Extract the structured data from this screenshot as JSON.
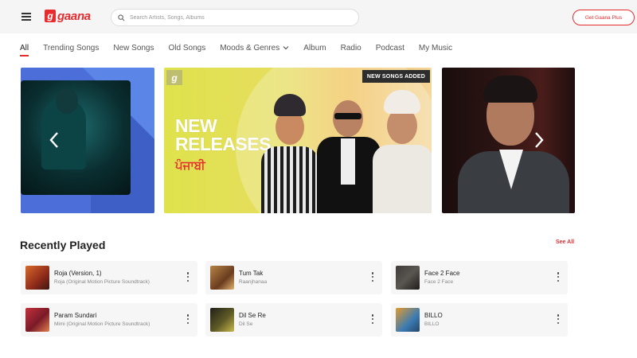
{
  "header": {
    "logo_letter": "g",
    "logo_text": "gaana",
    "search_placeholder": "Search Artists, Songs, Albums",
    "cta_label": "Get Gaana Plus"
  },
  "nav": {
    "items": [
      "All",
      "Trending Songs",
      "New Songs",
      "Old Songs",
      "Moods & Genres",
      "Album",
      "Radio",
      "Podcast",
      "My Music"
    ]
  },
  "carousel": {
    "badge_letter": "g",
    "new_songs_tag": "NEW SONGS ADDED",
    "headline_line1": "NEW",
    "headline_line2": "RELEASES",
    "language": "ਪੰਜਾਬੀ"
  },
  "recently_played": {
    "title": "Recently Played",
    "see_all": "See All",
    "items": [
      {
        "title": "Roja (Version, 1)",
        "subtitle": "Roja (Original Motion Picture Soundtrack)"
      },
      {
        "title": "Tum Tak",
        "subtitle": "Raanjhanaa"
      },
      {
        "title": "Face 2 Face",
        "subtitle": "Face 2 Face"
      },
      {
        "title": "Param Sundari",
        "subtitle": "Mimi (Original Motion Picture Soundtrack)"
      },
      {
        "title": "Dil Se Re",
        "subtitle": "Dil Se"
      },
      {
        "title": "BILLO",
        "subtitle": "BILLO"
      }
    ]
  },
  "colors": {
    "accent": "#e72c30",
    "header_bg": "#f5f5f5",
    "card_bg": "#f6f6f6"
  }
}
